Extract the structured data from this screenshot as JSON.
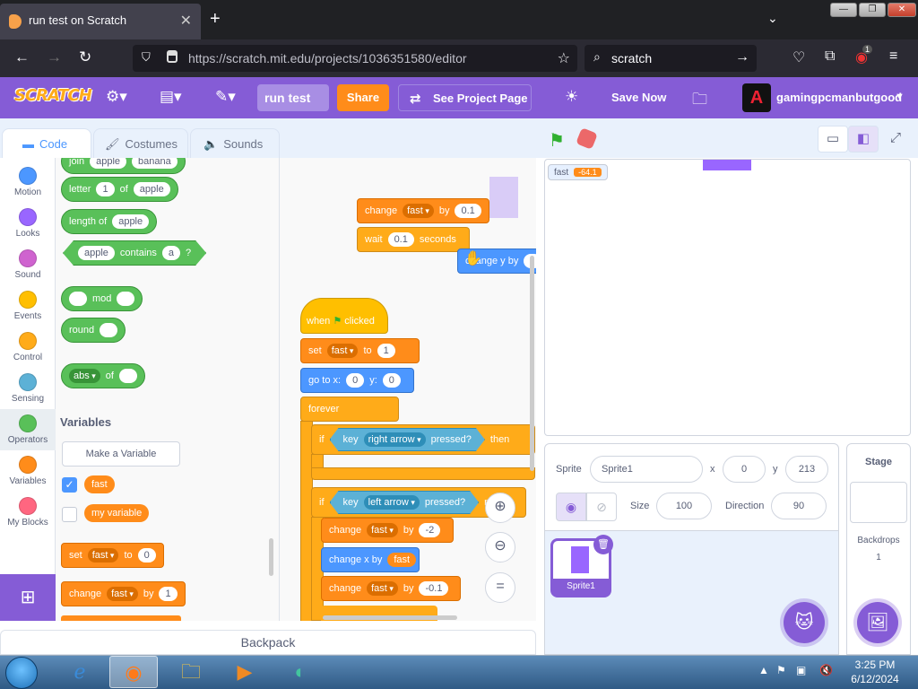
{
  "browser": {
    "tab_title": "run test on Scratch",
    "url": "https://scratch.mit.edu/projects/1036351580/editor",
    "search_text": "scratch",
    "ext_badge": "1"
  },
  "menubar": {
    "logo": "SCRATCH",
    "project_name": "run test",
    "share": "Share",
    "see_project": "See Project Page",
    "save_now": "Save Now",
    "username": "gamingpcmanbutgood",
    "avatar_letter": "A"
  },
  "tabs": {
    "code": "Code",
    "costumes": "Costumes",
    "sounds": "Sounds"
  },
  "categories": [
    {
      "label": "Motion",
      "color": "#4c97ff"
    },
    {
      "label": "Looks",
      "color": "#9966ff"
    },
    {
      "label": "Sound",
      "color": "#cf63cf"
    },
    {
      "label": "Events",
      "color": "#ffbf00"
    },
    {
      "label": "Control",
      "color": "#ffab19"
    },
    {
      "label": "Sensing",
      "color": "#5cb1d6"
    },
    {
      "label": "Operators",
      "color": "#59c059"
    },
    {
      "label": "Variables",
      "color": "#ff8c1a"
    },
    {
      "label": "My Blocks",
      "color": "#ff6680"
    }
  ],
  "palette": {
    "join": {
      "a": "apple",
      "b": "banana",
      "label": "join"
    },
    "letter": {
      "w1": "letter",
      "n": "1",
      "w2": "of",
      "s": "apple"
    },
    "length": {
      "w": "length of",
      "s": "apple"
    },
    "contains": {
      "s": "apple",
      "w": "contains",
      "t": "a",
      "q": "?"
    },
    "mod": "mod",
    "round": "round",
    "abs": {
      "fn": "abs",
      "of": "of"
    },
    "variables_title": "Variables",
    "make_var": "Make a Variable",
    "var1": "fast",
    "var2": "my variable",
    "set": {
      "w": "set",
      "v": "fast",
      "to": "to",
      "n": "0"
    },
    "change": {
      "w": "change",
      "v": "fast",
      "by": "by",
      "n": "1"
    }
  },
  "script": {
    "change1": {
      "w": "change",
      "v": "fast",
      "by": "by",
      "n": "0.1"
    },
    "wait": {
      "w": "wait",
      "n": "0.1",
      "s": "seconds"
    },
    "changey": {
      "w": "change y by"
    },
    "hat": {
      "w": "when",
      "w2": "clicked"
    },
    "set": {
      "w": "set",
      "v": "fast",
      "to": "to",
      "n": "1"
    },
    "goto": {
      "w": "go to x:",
      "x": "0",
      "yl": "y:",
      "y": "0"
    },
    "forever": "forever",
    "if1": {
      "if": "if",
      "key": "key",
      "k": "right arrow",
      "p": "pressed?",
      "then": "then"
    },
    "if2": {
      "if": "if",
      "key": "key",
      "k": "left arrow",
      "p": "pressed?",
      "then": "n"
    },
    "change2": {
      "w": "change",
      "v": "fast",
      "by": "by",
      "n": "-2"
    },
    "changex": {
      "w": "change x by",
      "v": "fast"
    },
    "change3": {
      "w": "change",
      "v": "fast",
      "by": "by",
      "n": "-0.1"
    }
  },
  "backpack": "Backpack",
  "stage": {
    "monitor_name": "fast",
    "monitor_value": "-64.1"
  },
  "sprite_info": {
    "sprite_label": "Sprite",
    "sprite_name": "Sprite1",
    "x_label": "x",
    "x": "0",
    "y_label": "y",
    "y": "213",
    "size_label": "Size",
    "size": "100",
    "direction_label": "Direction",
    "direction": "90"
  },
  "sprite_tile": "Sprite1",
  "stage_panel": {
    "title": "Stage",
    "backdrops": "Backdrops",
    "count": "1"
  },
  "clock": {
    "time": "3:25 PM",
    "date": "6/12/2024"
  }
}
